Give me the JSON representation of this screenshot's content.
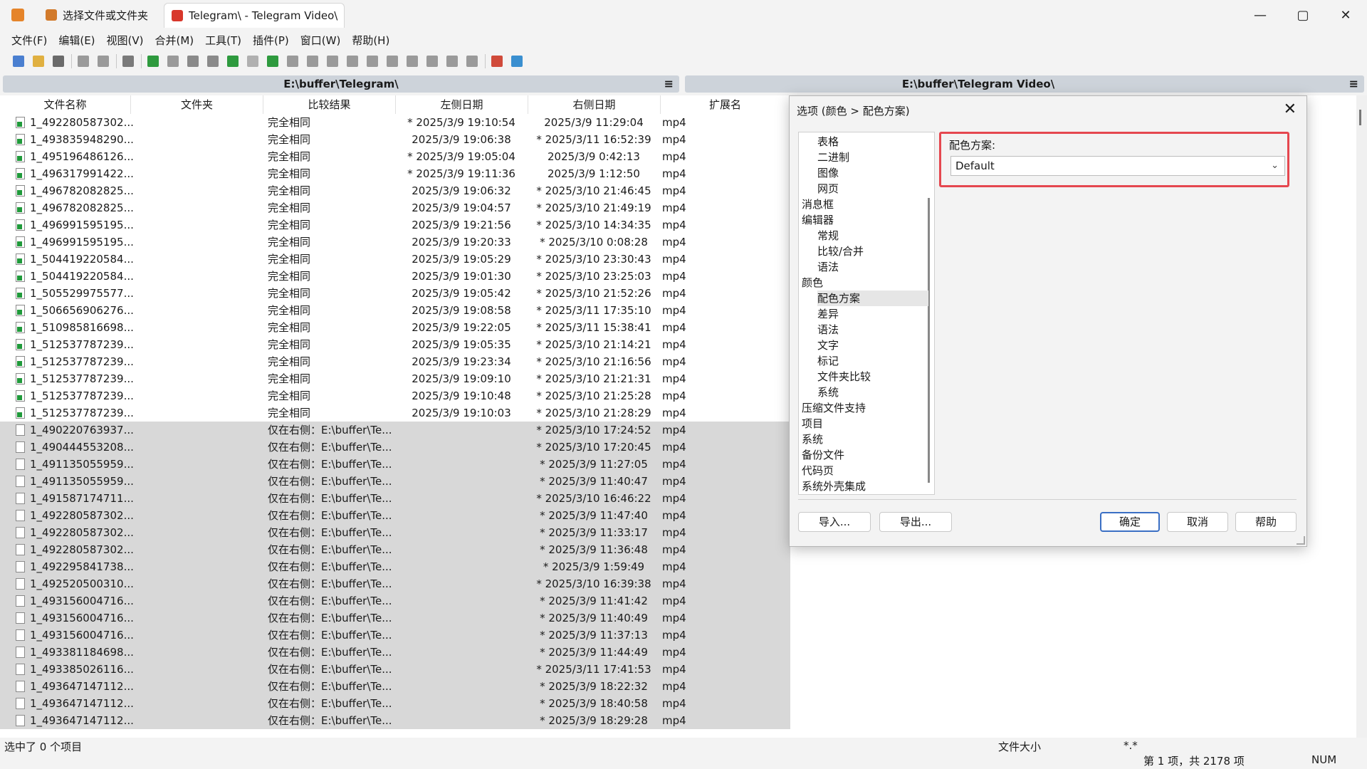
{
  "window": {
    "tabs": [
      {
        "label": "选择文件或文件夹",
        "icon": "folder-compare-icon"
      },
      {
        "label": "Telegram\\ - Telegram Video\\",
        "icon": "folder-compare-red-icon"
      }
    ],
    "controls": {
      "minimize": "—",
      "maximize": "▢",
      "close": "✕"
    }
  },
  "menu": [
    "文件(F)",
    "编辑(E)",
    "视图(V)",
    "合并(M)",
    "工具(T)",
    "插件(P)",
    "窗口(W)",
    "帮助(H)"
  ],
  "left_path": "E:\\buffer\\Telegram\\",
  "right_path": "E:\\buffer\\Telegram Video\\",
  "path_menu_glyph": "≡",
  "columns": [
    "文件名称",
    "文件夹",
    "比较结果",
    "左侧日期",
    "右侧日期",
    "扩展名"
  ],
  "rows": [
    {
      "name": "1_492280587302...",
      "result": "完全相同",
      "left_date": "* 2025/3/9 19:10:54",
      "right_date": "2025/3/9 11:29:04",
      "ext": "mp4",
      "type": "same"
    },
    {
      "name": "1_493835948290...",
      "result": "完全相同",
      "left_date": "2025/3/9 19:06:38",
      "right_date": "* 2025/3/11 16:52:39",
      "ext": "mp4",
      "type": "same"
    },
    {
      "name": "1_495196486126...",
      "result": "完全相同",
      "left_date": "* 2025/3/9 19:05:04",
      "right_date": "2025/3/9 0:42:13",
      "ext": "mp4",
      "type": "same"
    },
    {
      "name": "1_496317991422...",
      "result": "完全相同",
      "left_date": "* 2025/3/9 19:11:36",
      "right_date": "2025/3/9 1:12:50",
      "ext": "mp4",
      "type": "same"
    },
    {
      "name": "1_496782082825...",
      "result": "完全相同",
      "left_date": "2025/3/9 19:06:32",
      "right_date": "* 2025/3/10 21:46:45",
      "ext": "mp4",
      "type": "same"
    },
    {
      "name": "1_496782082825...",
      "result": "完全相同",
      "left_date": "2025/3/9 19:04:57",
      "right_date": "* 2025/3/10 21:49:19",
      "ext": "mp4",
      "type": "same"
    },
    {
      "name": "1_496991595195...",
      "result": "完全相同",
      "left_date": "2025/3/9 19:21:56",
      "right_date": "* 2025/3/10 14:34:35",
      "ext": "mp4",
      "type": "same"
    },
    {
      "name": "1_496991595195...",
      "result": "完全相同",
      "left_date": "2025/3/9 19:20:33",
      "right_date": "* 2025/3/10 0:08:28",
      "ext": "mp4",
      "type": "same"
    },
    {
      "name": "1_504419220584...",
      "result": "完全相同",
      "left_date": "2025/3/9 19:05:29",
      "right_date": "* 2025/3/10 23:30:43",
      "ext": "mp4",
      "type": "same"
    },
    {
      "name": "1_504419220584...",
      "result": "完全相同",
      "left_date": "2025/3/9 19:01:30",
      "right_date": "* 2025/3/10 23:25:03",
      "ext": "mp4",
      "type": "same"
    },
    {
      "name": "1_505529975577...",
      "result": "完全相同",
      "left_date": "2025/3/9 19:05:42",
      "right_date": "* 2025/3/10 21:52:26",
      "ext": "mp4",
      "type": "same"
    },
    {
      "name": "1_506656906276...",
      "result": "完全相同",
      "left_date": "2025/3/9 19:08:58",
      "right_date": "* 2025/3/11 17:35:10",
      "ext": "mp4",
      "type": "same"
    },
    {
      "name": "1_510985816698...",
      "result": "完全相同",
      "left_date": "2025/3/9 19:22:05",
      "right_date": "* 2025/3/11 15:38:41",
      "ext": "mp4",
      "type": "same"
    },
    {
      "name": "1_512537787239...",
      "result": "完全相同",
      "left_date": "2025/3/9 19:05:35",
      "right_date": "* 2025/3/10 21:14:21",
      "ext": "mp4",
      "type": "same"
    },
    {
      "name": "1_512537787239...",
      "result": "完全相同",
      "left_date": "2025/3/9 19:23:34",
      "right_date": "* 2025/3/10 21:16:56",
      "ext": "mp4",
      "type": "same"
    },
    {
      "name": "1_512537787239...",
      "result": "完全相同",
      "left_date": "2025/3/9 19:09:10",
      "right_date": "* 2025/3/10 21:21:31",
      "ext": "mp4",
      "type": "same"
    },
    {
      "name": "1_512537787239...",
      "result": "完全相同",
      "left_date": "2025/3/9 19:10:48",
      "right_date": "* 2025/3/10 21:25:28",
      "ext": "mp4",
      "type": "same"
    },
    {
      "name": "1_512537787239...",
      "result": "完全相同",
      "left_date": "2025/3/9 19:10:03",
      "right_date": "* 2025/3/10 21:28:29",
      "ext": "mp4",
      "type": "same"
    },
    {
      "name": "1_490220763937...",
      "result": "仅在右侧：E:\\buffer\\Te...",
      "left_date": "",
      "right_date": "* 2025/3/10 17:24:52",
      "ext": "mp4",
      "type": "right"
    },
    {
      "name": "1_490444553208...",
      "result": "仅在右侧：E:\\buffer\\Te...",
      "left_date": "",
      "right_date": "* 2025/3/10 17:20:45",
      "ext": "mp4",
      "type": "right"
    },
    {
      "name": "1_491135055959...",
      "result": "仅在右侧：E:\\buffer\\Te...",
      "left_date": "",
      "right_date": "* 2025/3/9 11:27:05",
      "ext": "mp4",
      "type": "right"
    },
    {
      "name": "1_491135055959...",
      "result": "仅在右侧：E:\\buffer\\Te...",
      "left_date": "",
      "right_date": "* 2025/3/9 11:40:47",
      "ext": "mp4",
      "type": "right"
    },
    {
      "name": "1_491587174711...",
      "result": "仅在右侧：E:\\buffer\\Te...",
      "left_date": "",
      "right_date": "* 2025/3/10 16:46:22",
      "ext": "mp4",
      "type": "right"
    },
    {
      "name": "1_492280587302...",
      "result": "仅在右侧：E:\\buffer\\Te...",
      "left_date": "",
      "right_date": "* 2025/3/9 11:47:40",
      "ext": "mp4",
      "type": "right"
    },
    {
      "name": "1_492280587302...",
      "result": "仅在右侧：E:\\buffer\\Te...",
      "left_date": "",
      "right_date": "* 2025/3/9 11:33:17",
      "ext": "mp4",
      "type": "right"
    },
    {
      "name": "1_492280587302...",
      "result": "仅在右侧：E:\\buffer\\Te...",
      "left_date": "",
      "right_date": "* 2025/3/9 11:36:48",
      "ext": "mp4",
      "type": "right"
    },
    {
      "name": "1_492295841738...",
      "result": "仅在右侧：E:\\buffer\\Te...",
      "left_date": "",
      "right_date": "* 2025/3/9 1:59:49",
      "ext": "mp4",
      "type": "right"
    },
    {
      "name": "1_492520500310...",
      "result": "仅在右侧：E:\\buffer\\Te...",
      "left_date": "",
      "right_date": "* 2025/3/10 16:39:38",
      "ext": "mp4",
      "type": "right"
    },
    {
      "name": "1_493156004716...",
      "result": "仅在右侧：E:\\buffer\\Te...",
      "left_date": "",
      "right_date": "* 2025/3/9 11:41:42",
      "ext": "mp4",
      "type": "right"
    },
    {
      "name": "1_493156004716...",
      "result": "仅在右侧：E:\\buffer\\Te...",
      "left_date": "",
      "right_date": "* 2025/3/9 11:40:49",
      "ext": "mp4",
      "type": "right"
    },
    {
      "name": "1_493156004716...",
      "result": "仅在右侧：E:\\buffer\\Te...",
      "left_date": "",
      "right_date": "* 2025/3/9 11:37:13",
      "ext": "mp4",
      "type": "right"
    },
    {
      "name": "1_493381184698...",
      "result": "仅在右侧：E:\\buffer\\Te...",
      "left_date": "",
      "right_date": "* 2025/3/9 11:44:49",
      "ext": "mp4",
      "type": "right"
    },
    {
      "name": "1_493385026116...",
      "result": "仅在右侧：E:\\buffer\\Te...",
      "left_date": "",
      "right_date": "* 2025/3/11 17:41:53",
      "ext": "mp4",
      "type": "right"
    },
    {
      "name": "1_493647147112...",
      "result": "仅在右侧：E:\\buffer\\Te...",
      "left_date": "",
      "right_date": "* 2025/3/9 18:22:32",
      "ext": "mp4",
      "type": "right"
    },
    {
      "name": "1_493647147112...",
      "result": "仅在右侧：E:\\buffer\\Te...",
      "left_date": "",
      "right_date": "* 2025/3/9 18:40:58",
      "ext": "mp4",
      "type": "right"
    },
    {
      "name": "1_493647147112...",
      "result": "仅在右侧：E:\\buffer\\Te...",
      "left_date": "",
      "right_date": "* 2025/3/9 18:29:28",
      "ext": "mp4",
      "type": "right"
    }
  ],
  "status": {
    "selected": "选中了 0 个项目",
    "file_size_label": "文件大小",
    "filter": "*.*",
    "position": "第 1 项，共 2178 项",
    "num": "NUM"
  },
  "dialog": {
    "title": "选项 (颜色 > 配色方案)",
    "close": "✕",
    "tree": [
      {
        "label": "表格",
        "level": 1
      },
      {
        "label": "二进制",
        "level": 1
      },
      {
        "label": "图像",
        "level": 1
      },
      {
        "label": "网页",
        "level": 1
      },
      {
        "label": "消息框",
        "level": 0
      },
      {
        "label": "编辑器",
        "level": 0
      },
      {
        "label": "常规",
        "level": 1
      },
      {
        "label": "比较/合并",
        "level": 1
      },
      {
        "label": "语法",
        "level": 1
      },
      {
        "label": "颜色",
        "level": 0
      },
      {
        "label": "配色方案",
        "level": 1,
        "selected": true
      },
      {
        "label": "差异",
        "level": 1
      },
      {
        "label": "语法",
        "level": 1
      },
      {
        "label": "文字",
        "level": 1
      },
      {
        "label": "标记",
        "level": 1
      },
      {
        "label": "文件夹比较",
        "level": 1
      },
      {
        "label": "系统",
        "level": 1
      },
      {
        "label": "压缩文件支持",
        "level": 0
      },
      {
        "label": "项目",
        "level": 0
      },
      {
        "label": "系统",
        "level": 0
      },
      {
        "label": "备份文件",
        "level": 0
      },
      {
        "label": "代码页",
        "level": 0
      },
      {
        "label": "系统外壳集成",
        "level": 0
      }
    ],
    "scheme_label": "配色方案:",
    "scheme_value": "Default",
    "buttons": {
      "import": "导入...",
      "export": "导出...",
      "ok": "确定",
      "cancel": "取消",
      "help": "帮助"
    }
  },
  "colors": {
    "highlight_red": "#e5474f",
    "primary_button_border": "#3a6fc4",
    "row_gray": "#d8d8d8"
  }
}
